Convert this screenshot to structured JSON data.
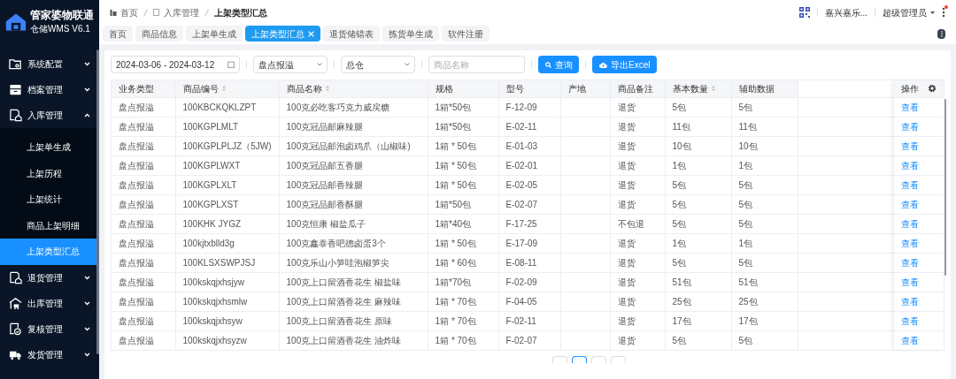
{
  "brand": {
    "title": "管家婆物联通",
    "subtitle": "仓储WMS V6.1"
  },
  "sidebar": {
    "items": [
      {
        "label": "系统配置",
        "expanded": false,
        "selected": false
      },
      {
        "label": "档案管理",
        "expanded": false,
        "selected": false
      },
      {
        "label": "入库管理",
        "expanded": true,
        "selected": false,
        "children": [
          {
            "label": "上架单生成",
            "selected": false
          },
          {
            "label": "上架历程",
            "selected": false
          },
          {
            "label": "上架统计",
            "selected": false
          },
          {
            "label": "商品上架明细",
            "selected": false
          },
          {
            "label": "上架类型汇总",
            "selected": true
          }
        ]
      },
      {
        "label": "退货管理",
        "expanded": false,
        "selected": false
      },
      {
        "label": "出库管理",
        "expanded": false,
        "selected": false
      },
      {
        "label": "复核管理",
        "expanded": false,
        "selected": false
      },
      {
        "label": "发货管理",
        "expanded": false,
        "selected": false
      }
    ]
  },
  "breadcrumb": [
    "首页",
    "入库管理",
    "上架类型汇总"
  ],
  "user": {
    "company": "嘉兴嘉乐...",
    "name": "超级管理员",
    "notification": true
  },
  "tabs": [
    {
      "label": "首页",
      "selected": false,
      "closable": false
    },
    {
      "label": "商品信息",
      "selected": false,
      "closable": false
    },
    {
      "label": "上架单生成",
      "selected": false,
      "closable": false
    },
    {
      "label": "上架类型汇总",
      "selected": true,
      "closable": true
    },
    {
      "label": "退货储错表",
      "selected": false,
      "closable": false
    },
    {
      "label": "拣货单生成",
      "selected": false,
      "closable": false
    },
    {
      "label": "软件注册",
      "selected": false,
      "closable": false
    }
  ],
  "filters": {
    "date_range": "2024-03-06 - 2024-03-12",
    "type": "盘点报溢",
    "warehouse": "总仓",
    "product_placeholder": "商品名称",
    "search_button": "查询",
    "export_button": "导出Excel"
  },
  "table": {
    "columns": [
      {
        "label": "业务类型",
        "sortable": false
      },
      {
        "label": "商品编号",
        "sortable": true
      },
      {
        "label": "商品名称",
        "sortable": true
      },
      {
        "label": "规格",
        "sortable": false
      },
      {
        "label": "型号",
        "sortable": false
      },
      {
        "label": "产地",
        "sortable": false
      },
      {
        "label": "商品备注",
        "sortable": false
      },
      {
        "label": "基本数量",
        "sortable": true
      },
      {
        "label": "辅助数据",
        "sortable": false
      }
    ],
    "action_column": "操作",
    "rows": [
      {
        "cells": [
          "盘点报溢",
          "100KBCKQKLZPT",
          "100克必吃客巧克力威戻糖",
          "1箱*50包",
          "F-12-09",
          "",
          "退货",
          "5包",
          "5包"
        ],
        "action": "查看"
      },
      {
        "cells": [
          "盘点报溢",
          "100KGPLMLT",
          "100克冠品邮麻辣腿",
          "1箱*50包",
          "E-02-11",
          "",
          "退货",
          "11包",
          "11包"
        ],
        "action": "查看"
      },
      {
        "cells": [
          "盘点报溢",
          "100KGPLPLJZ（5JW)",
          "100克冠品邮泡卤鸡爪（山椒味)",
          "1箱 * 50包",
          "E-01-03",
          "",
          "退货",
          "10包",
          "10包"
        ],
        "action": "查看"
      },
      {
        "cells": [
          "盘点报溢",
          "100KGPLWXT",
          "100克冠品邮五香腿",
          "1箱 * 50包",
          "E-02-01",
          "",
          "退货",
          "1包",
          "1包"
        ],
        "action": "查看"
      },
      {
        "cells": [
          "盘点报溢",
          "100KGPLXLT",
          "100克冠品邮香辣腿",
          "1箱 * 50包",
          "E-02-05",
          "",
          "退货",
          "5包",
          "5包"
        ],
        "action": "查看"
      },
      {
        "cells": [
          "盘点报溢",
          "100KGPLXST",
          "100克冠品邮香酥腿",
          "1箱*50包",
          "E-02-07",
          "",
          "退货",
          "5包",
          "5包"
        ],
        "action": "查看"
      },
      {
        "cells": [
          "盘点报溢",
          "100KHK JYGZ",
          "100克恒康 椒盐瓜子",
          "1箱*40包",
          "F-17-25",
          "",
          "不包退",
          "5包",
          "5包"
        ],
        "action": "查看"
      },
      {
        "cells": [
          "盘点报溢",
          "100kjtxblld3g",
          "100克鑫泰香吧德卤蛋3个",
          "1箱 * 50包",
          "E-17-09",
          "",
          "退货",
          "1包",
          "1包"
        ],
        "action": "查看"
      },
      {
        "cells": [
          "盘点报溢",
          "100KLSXSWPJSJ",
          "100克乐山小笋哇泡椒笋尖",
          "1箱 * 60包",
          "E-08-11",
          "",
          "退货",
          "5包",
          "5包"
        ],
        "action": "查看"
      },
      {
        "cells": [
          "盘点报溢",
          "100kskqjxhsjyw",
          "100克上口留酒香花生 椒盐味",
          "1箱*70包",
          "F-02-09",
          "",
          "退货",
          "51包",
          "51包"
        ],
        "action": "查看"
      },
      {
        "cells": [
          "盘点报溢",
          "100kskqjxhsmlw",
          "100克上口留酒香花生 麻辣味",
          "1箱 * 70包",
          "F-04-05",
          "",
          "退货",
          "25包",
          "25包"
        ],
        "action": "查看"
      },
      {
        "cells": [
          "盘点报溢",
          "100kskqjxhsyw",
          "100克上口留酒香花生 原味",
          "1箱 * 70包",
          "F-02-11",
          "",
          "退货",
          "17包",
          "17包"
        ],
        "action": "查看"
      },
      {
        "cells": [
          "盘点报溢",
          "100kskqjxhsyzw",
          "100克上口留酒香花生 油炸味",
          "1箱 * 70包",
          "F-02-07",
          "",
          "退货",
          "5包",
          "5包"
        ],
        "action": "查看"
      }
    ]
  }
}
